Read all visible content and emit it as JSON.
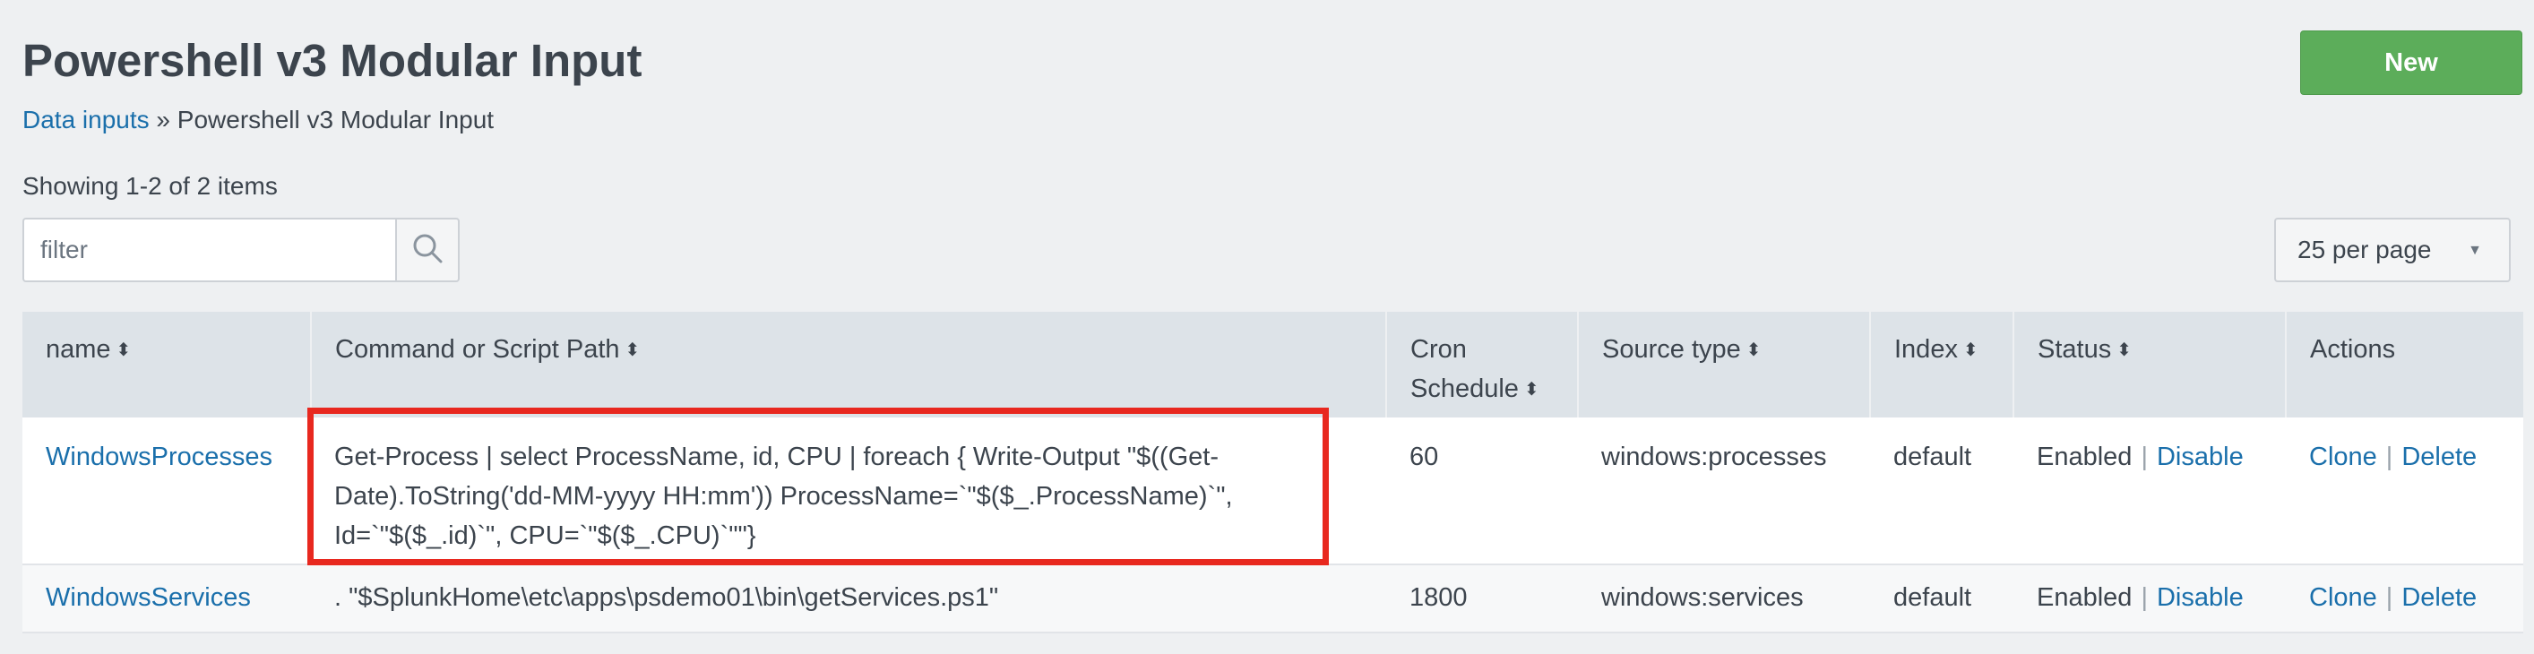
{
  "header": {
    "title": "Powershell v3 Modular Input",
    "new_button_label": "New"
  },
  "breadcrumb": {
    "link": "Data inputs",
    "separator": "»",
    "current": "Powershell v3 Modular Input"
  },
  "listing": {
    "count_text": "Showing 1-2 of 2 items",
    "filter_placeholder": "filter",
    "per_page": "25 per page"
  },
  "icons": {
    "search": "search-icon",
    "sort": "sort-icon",
    "caret": "chevron-down-icon"
  },
  "table": {
    "columns": [
      {
        "label": "name"
      },
      {
        "label": "Command or Script Path"
      },
      {
        "label": "Cron Schedule"
      },
      {
        "label": "Source type"
      },
      {
        "label": "Index"
      },
      {
        "label": "Status"
      },
      {
        "label": "Actions"
      }
    ],
    "rows": [
      {
        "name": "WindowsProcesses",
        "command": "Get-Process | select ProcessName, id, CPU | foreach { Write-Output \"$((Get-Date).ToString('dd-MM-yyyy HH:mm')) ProcessName=`\"$($_.ProcessName)`\", Id=`\"$($_.id)`\", CPU=`\"$($_.CPU)`\"\"}",
        "cron": "60",
        "sourcetype": "windows:processes",
        "index": "default",
        "status": "Enabled",
        "status_action": "Disable",
        "action_clone": "Clone",
        "action_delete": "Delete"
      },
      {
        "name": "WindowsServices",
        "command": ". \"$SplunkHome\\etc\\apps\\psdemo01\\bin\\getServices.ps1\"",
        "cron": "1800",
        "sourcetype": "windows:services",
        "index": "default",
        "status": "Enabled",
        "status_action": "Disable",
        "action_clone": "Clone",
        "action_delete": "Delete"
      }
    ]
  },
  "colors": {
    "accent_link": "#1a6fab",
    "new_button": "#5cad5a",
    "highlight": "#e8281f",
    "header_bg": "#dde3e8"
  }
}
